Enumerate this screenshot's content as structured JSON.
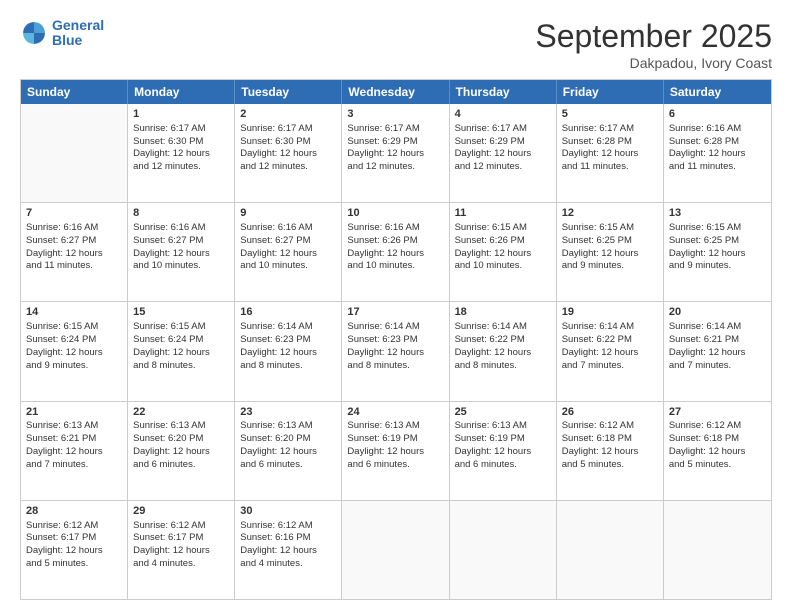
{
  "logo": {
    "line1": "General",
    "line2": "Blue"
  },
  "title": "September 2025",
  "location": "Dakpadou, Ivory Coast",
  "days_header": [
    "Sunday",
    "Monday",
    "Tuesday",
    "Wednesday",
    "Thursday",
    "Friday",
    "Saturday"
  ],
  "weeks": [
    [
      {
        "day": "",
        "text": ""
      },
      {
        "day": "1",
        "text": "Sunrise: 6:17 AM\nSunset: 6:30 PM\nDaylight: 12 hours\nand 12 minutes."
      },
      {
        "day": "2",
        "text": "Sunrise: 6:17 AM\nSunset: 6:30 PM\nDaylight: 12 hours\nand 12 minutes."
      },
      {
        "day": "3",
        "text": "Sunrise: 6:17 AM\nSunset: 6:29 PM\nDaylight: 12 hours\nand 12 minutes."
      },
      {
        "day": "4",
        "text": "Sunrise: 6:17 AM\nSunset: 6:29 PM\nDaylight: 12 hours\nand 12 minutes."
      },
      {
        "day": "5",
        "text": "Sunrise: 6:17 AM\nSunset: 6:28 PM\nDaylight: 12 hours\nand 11 minutes."
      },
      {
        "day": "6",
        "text": "Sunrise: 6:16 AM\nSunset: 6:28 PM\nDaylight: 12 hours\nand 11 minutes."
      }
    ],
    [
      {
        "day": "7",
        "text": "Sunrise: 6:16 AM\nSunset: 6:27 PM\nDaylight: 12 hours\nand 11 minutes."
      },
      {
        "day": "8",
        "text": "Sunrise: 6:16 AM\nSunset: 6:27 PM\nDaylight: 12 hours\nand 10 minutes."
      },
      {
        "day": "9",
        "text": "Sunrise: 6:16 AM\nSunset: 6:27 PM\nDaylight: 12 hours\nand 10 minutes."
      },
      {
        "day": "10",
        "text": "Sunrise: 6:16 AM\nSunset: 6:26 PM\nDaylight: 12 hours\nand 10 minutes."
      },
      {
        "day": "11",
        "text": "Sunrise: 6:15 AM\nSunset: 6:26 PM\nDaylight: 12 hours\nand 10 minutes."
      },
      {
        "day": "12",
        "text": "Sunrise: 6:15 AM\nSunset: 6:25 PM\nDaylight: 12 hours\nand 9 minutes."
      },
      {
        "day": "13",
        "text": "Sunrise: 6:15 AM\nSunset: 6:25 PM\nDaylight: 12 hours\nand 9 minutes."
      }
    ],
    [
      {
        "day": "14",
        "text": "Sunrise: 6:15 AM\nSunset: 6:24 PM\nDaylight: 12 hours\nand 9 minutes."
      },
      {
        "day": "15",
        "text": "Sunrise: 6:15 AM\nSunset: 6:24 PM\nDaylight: 12 hours\nand 8 minutes."
      },
      {
        "day": "16",
        "text": "Sunrise: 6:14 AM\nSunset: 6:23 PM\nDaylight: 12 hours\nand 8 minutes."
      },
      {
        "day": "17",
        "text": "Sunrise: 6:14 AM\nSunset: 6:23 PM\nDaylight: 12 hours\nand 8 minutes."
      },
      {
        "day": "18",
        "text": "Sunrise: 6:14 AM\nSunset: 6:22 PM\nDaylight: 12 hours\nand 8 minutes."
      },
      {
        "day": "19",
        "text": "Sunrise: 6:14 AM\nSunset: 6:22 PM\nDaylight: 12 hours\nand 7 minutes."
      },
      {
        "day": "20",
        "text": "Sunrise: 6:14 AM\nSunset: 6:21 PM\nDaylight: 12 hours\nand 7 minutes."
      }
    ],
    [
      {
        "day": "21",
        "text": "Sunrise: 6:13 AM\nSunset: 6:21 PM\nDaylight: 12 hours\nand 7 minutes."
      },
      {
        "day": "22",
        "text": "Sunrise: 6:13 AM\nSunset: 6:20 PM\nDaylight: 12 hours\nand 6 minutes."
      },
      {
        "day": "23",
        "text": "Sunrise: 6:13 AM\nSunset: 6:20 PM\nDaylight: 12 hours\nand 6 minutes."
      },
      {
        "day": "24",
        "text": "Sunrise: 6:13 AM\nSunset: 6:19 PM\nDaylight: 12 hours\nand 6 minutes."
      },
      {
        "day": "25",
        "text": "Sunrise: 6:13 AM\nSunset: 6:19 PM\nDaylight: 12 hours\nand 6 minutes."
      },
      {
        "day": "26",
        "text": "Sunrise: 6:12 AM\nSunset: 6:18 PM\nDaylight: 12 hours\nand 5 minutes."
      },
      {
        "day": "27",
        "text": "Sunrise: 6:12 AM\nSunset: 6:18 PM\nDaylight: 12 hours\nand 5 minutes."
      }
    ],
    [
      {
        "day": "28",
        "text": "Sunrise: 6:12 AM\nSunset: 6:17 PM\nDaylight: 12 hours\nand 5 minutes."
      },
      {
        "day": "29",
        "text": "Sunrise: 6:12 AM\nSunset: 6:17 PM\nDaylight: 12 hours\nand 4 minutes."
      },
      {
        "day": "30",
        "text": "Sunrise: 6:12 AM\nSunset: 6:16 PM\nDaylight: 12 hours\nand 4 minutes."
      },
      {
        "day": "",
        "text": ""
      },
      {
        "day": "",
        "text": ""
      },
      {
        "day": "",
        "text": ""
      },
      {
        "day": "",
        "text": ""
      }
    ]
  ]
}
